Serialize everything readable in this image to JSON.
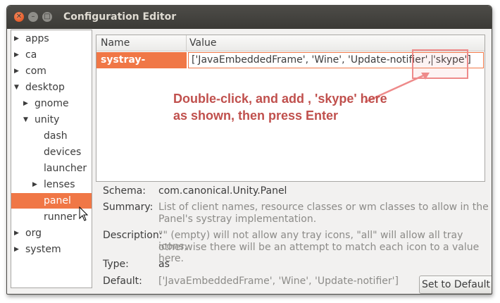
{
  "window": {
    "title": "Configuration Editor"
  },
  "tree": [
    {
      "label": "apps",
      "arrow": "▶"
    },
    {
      "label": "ca",
      "arrow": "▶"
    },
    {
      "label": "com",
      "arrow": "▶"
    },
    {
      "label": "desktop",
      "arrow": "▼"
    },
    {
      "label": "gnome",
      "arrow": "▶"
    },
    {
      "label": "unity",
      "arrow": "▼"
    },
    {
      "label": "dash",
      "arrow": ""
    },
    {
      "label": "devices",
      "arrow": ""
    },
    {
      "label": "launcher",
      "arrow": ""
    },
    {
      "label": "lenses",
      "arrow": "▶"
    },
    {
      "label": "panel",
      "arrow": ""
    },
    {
      "label": "runner",
      "arrow": ""
    },
    {
      "label": "org",
      "arrow": "▶"
    },
    {
      "label": "system",
      "arrow": "▶"
    }
  ],
  "grid": {
    "col_name": "Name",
    "col_value": "Value",
    "key": "systray-whitelist",
    "value_before_caret": "['JavaEmbeddedFrame', 'Wine', 'Update-notifier',",
    "value_after_caret": "'skype']"
  },
  "annotation": {
    "line1": "Double-click, and add , 'skype' here",
    "line2": "as shown, then press Enter"
  },
  "info": {
    "schema_label": "Schema:",
    "schema_value": "com.canonical.Unity.Panel",
    "summary_label": "Summary:",
    "summary_line1": "List of client names, resource classes or wm classes to allow in the",
    "summary_line2": "Panel's systray implementation.",
    "description_label": "Description:",
    "description_line1": "\"\" (empty) will not allow any tray icons, \"all\" will allow all tray icons,",
    "description_line2": "otherwise there will be an attempt to match each icon to a value here.",
    "type_label": "Type:",
    "type_value": "as",
    "default_label": "Default:",
    "default_value": "['JavaEmbeddedFrame', 'Wine', 'Update-notifier']"
  },
  "buttons": {
    "set_default": "Set to Default"
  }
}
